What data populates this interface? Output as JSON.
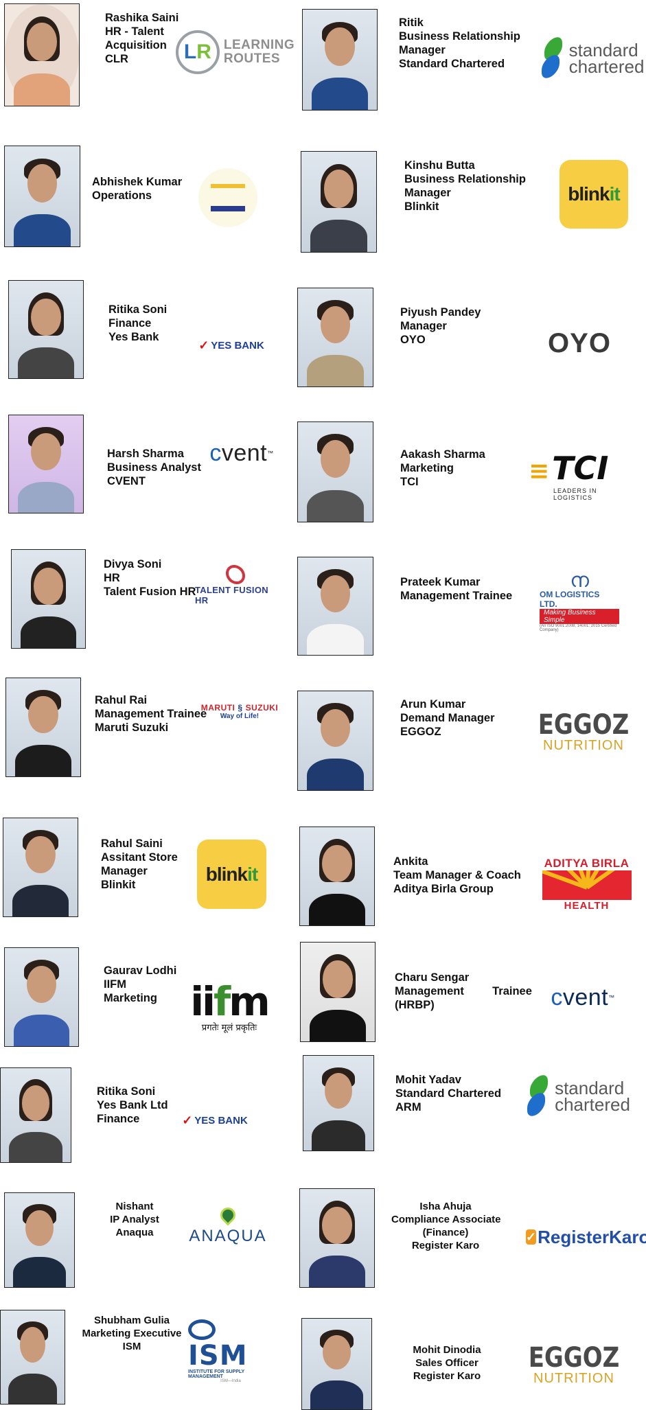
{
  "people": [
    {
      "lines": [
        "Rashika Saini",
        "HR - Talent",
        "Acquisition",
        "CLR"
      ]
    },
    {
      "lines": [
        "Ritik",
        "Business Relationship",
        "Manager",
        "Standard Chartered"
      ]
    },
    {
      "lines": [
        "Abhishek Kumar",
        "Operations"
      ]
    },
    {
      "lines": [
        "Kinshu Butta",
        "Business Relationship",
        "Manager",
        "Blinkit"
      ]
    },
    {
      "lines": [
        "Ritika Soni",
        "Finance",
        "Yes Bank"
      ]
    },
    {
      "lines": [
        "Piyush Pandey",
        "Manager",
        "OYO"
      ]
    },
    {
      "lines": [
        "Harsh Sharma",
        "Business Analyst",
        "CVENT"
      ]
    },
    {
      "lines": [
        "Aakash Sharma",
        "Marketing",
        "TCI"
      ]
    },
    {
      "lines": [
        "Divya Soni",
        "HR",
        "Talent Fusion HR"
      ]
    },
    {
      "lines": [
        "Prateek Kumar",
        "Management Trainee"
      ]
    },
    {
      "lines": [
        "Rahul Rai",
        "Management Trainee",
        "Maruti Suzuki"
      ]
    },
    {
      "lines": [
        "Arun Kumar",
        "Demand Manager",
        "EGGOZ"
      ]
    },
    {
      "lines": [
        "Rahul Saini",
        "Assitant Store",
        "Manager",
        "Blinkit"
      ]
    },
    {
      "lines": [
        "Ankita",
        "Team Manager & Coach",
        "Aditya Birla Group"
      ]
    },
    {
      "lines": [
        "Gaurav Lodhi",
        "IIFM",
        "Marketing"
      ]
    },
    {
      "lines": [
        "Charu Sengar",
        "Management         Trainee",
        "(HRBP)"
      ]
    },
    {
      "lines": [
        "Ritika Soni",
        "Yes Bank Ltd",
        "Finance"
      ]
    },
    {
      "lines": [
        "Mohit Yadav",
        "Standard Chartered",
        "ARM"
      ]
    },
    {
      "lines": [
        "Nishant",
        "IP Analyst",
        "Anaqua"
      ]
    },
    {
      "lines": [
        "Isha Ahuja",
        "Compliance Associate",
        "(Finance)",
        "Register Karo"
      ]
    },
    {
      "lines": [
        "Shubham Gulia",
        "Marketing Executive",
        "ISM"
      ]
    },
    {
      "lines": [
        "Mohit Dinodia",
        "Sales Officer",
        "Register Karo"
      ]
    }
  ],
  "logos": {
    "learning_routes": {
      "mark": "L",
      "mark2": "R",
      "line1": "LEARNING",
      "line2": "ROUTES"
    },
    "standard_chartered": {
      "line1": "standard",
      "line2": "chartered"
    },
    "blinkit": {
      "part1": "blink",
      "part2": "it"
    },
    "yes_bank": {
      "tick": "✓",
      "text": "YES BANK"
    },
    "oyo": {
      "text": "OYO"
    },
    "cvent": {
      "c": "c",
      "rest": "vent",
      "tm": "™"
    },
    "tci": {
      "bolt": "≡",
      "text": "TCI",
      "tagline": "LEADERS IN LOGISTICS"
    },
    "talent_fusion": {
      "text": "TALENT FUSION HR"
    },
    "om_logistics": {
      "text": "OM LOGISTICS LTD.",
      "tagline": "Making Business Simple",
      "small": "(An ISO 9001:2008, 14001: 2015 Certified Company)"
    },
    "maruti": {
      "left": "MARUTI",
      "sym": "§",
      "right": "SUZUKI",
      "tagline": "Way of Life!"
    },
    "eggoz": {
      "line1": "EGGOZ",
      "line2": "NUTRITION"
    },
    "aditya_birla": {
      "line1": "ADITYA BIRLA",
      "line2": "HEALTH"
    },
    "iifm": {
      "i": "ii",
      "f": "f",
      "m": "m",
      "tagline": "प्रगतेः मूलं प्रकृतिः"
    },
    "anaqua": {
      "text": "ANAQUA"
    },
    "register_karo": {
      "check": "✓",
      "text": "RegisterKaro"
    },
    "ism": {
      "text": "ISM",
      "line2": "INSTITUTE FOR SUPPLY MANAGEMENT",
      "line3": "ISM—India"
    }
  }
}
